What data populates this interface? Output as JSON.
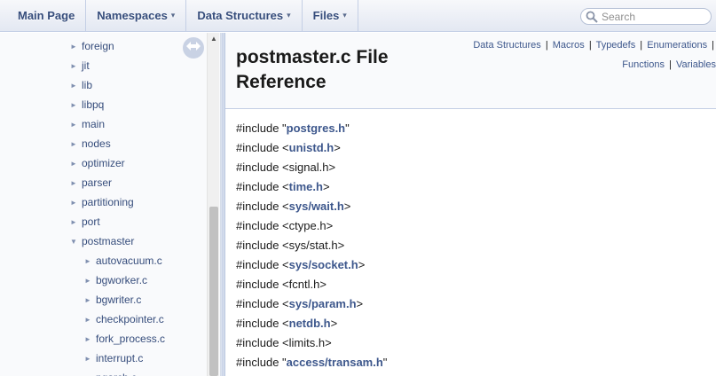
{
  "navbar": {
    "items": [
      {
        "label": "Main Page",
        "has_caret": false
      },
      {
        "label": "Namespaces",
        "has_caret": true
      },
      {
        "label": "Data Structures",
        "has_caret": true
      },
      {
        "label": "Files",
        "has_caret": true
      }
    ],
    "search_placeholder": "Search",
    "caret_glyph": "▾"
  },
  "sidebar": {
    "arrow_collapsed": "►",
    "arrow_expanded": "▼",
    "items": [
      {
        "label": "foreign",
        "level": 0,
        "expanded": false
      },
      {
        "label": "jit",
        "level": 0,
        "expanded": false
      },
      {
        "label": "lib",
        "level": 0,
        "expanded": false
      },
      {
        "label": "libpq",
        "level": 0,
        "expanded": false
      },
      {
        "label": "main",
        "level": 0,
        "expanded": false
      },
      {
        "label": "nodes",
        "level": 0,
        "expanded": false
      },
      {
        "label": "optimizer",
        "level": 0,
        "expanded": false
      },
      {
        "label": "parser",
        "level": 0,
        "expanded": false
      },
      {
        "label": "partitioning",
        "level": 0,
        "expanded": false
      },
      {
        "label": "port",
        "level": 0,
        "expanded": false
      },
      {
        "label": "postmaster",
        "level": 0,
        "expanded": true
      },
      {
        "label": "autovacuum.c",
        "level": 1,
        "expanded": false
      },
      {
        "label": "bgworker.c",
        "level": 1,
        "expanded": false
      },
      {
        "label": "bgwriter.c",
        "level": 1,
        "expanded": false
      },
      {
        "label": "checkpointer.c",
        "level": 1,
        "expanded": false
      },
      {
        "label": "fork_process.c",
        "level": 1,
        "expanded": false
      },
      {
        "label": "interrupt.c",
        "level": 1,
        "expanded": false
      },
      {
        "label": "pgarch.c",
        "level": 1,
        "expanded": false
      }
    ],
    "scroll_up_glyph": "▲"
  },
  "header": {
    "title_line1": "postmaster.c File",
    "title_line2": "Reference",
    "summary_links": [
      "Data Structures",
      "Macros",
      "Typedefs",
      "Enumerations",
      "Functions",
      "Variables"
    ],
    "separator": "|"
  },
  "includes": {
    "prefix": "#include ",
    "lines": [
      {
        "open": "\"",
        "name": "postgres.h",
        "close": "\"",
        "link": true
      },
      {
        "open": "<",
        "name": "unistd.h",
        "close": ">",
        "link": true
      },
      {
        "open": "<",
        "name": "signal.h",
        "close": ">",
        "link": false
      },
      {
        "open": "<",
        "name": "time.h",
        "close": ">",
        "link": true
      },
      {
        "open": "<",
        "name": "sys/wait.h",
        "close": ">",
        "link": true
      },
      {
        "open": "<",
        "name": "ctype.h",
        "close": ">",
        "link": false
      },
      {
        "open": "<",
        "name": "sys/stat.h",
        "close": ">",
        "link": false
      },
      {
        "open": "<",
        "name": "sys/socket.h",
        "close": ">",
        "link": true
      },
      {
        "open": "<",
        "name": "fcntl.h",
        "close": ">",
        "link": false
      },
      {
        "open": "<",
        "name": "sys/param.h",
        "close": ">",
        "link": true
      },
      {
        "open": "<",
        "name": "netdb.h",
        "close": ">",
        "link": true
      },
      {
        "open": "<",
        "name": "limits.h",
        "close": ">",
        "link": false
      },
      {
        "open": "\"",
        "name": "access/transam.h",
        "close": "\"",
        "link": true
      }
    ]
  },
  "colors": {
    "link": "#3d578c",
    "nav_text": "#364d7c",
    "border": "#c4cfe5"
  }
}
